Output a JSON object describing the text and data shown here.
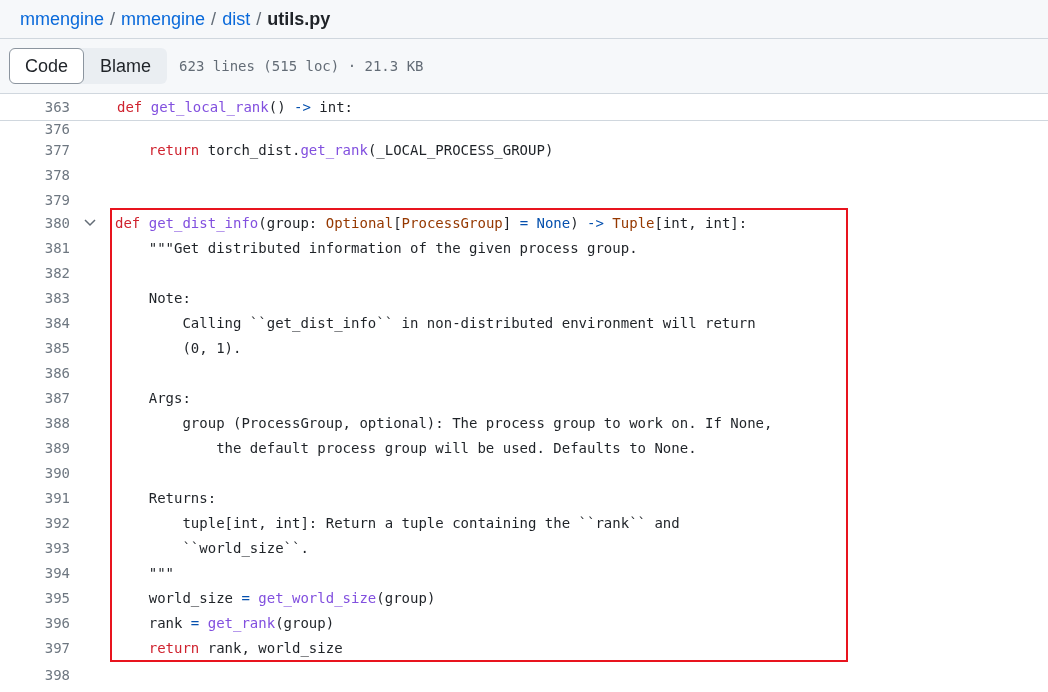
{
  "breadcrumb": [
    {
      "label": "mmengine",
      "kind": "link"
    },
    {
      "label": "/",
      "kind": "sep"
    },
    {
      "label": "mmengine",
      "kind": "link"
    },
    {
      "label": "/",
      "kind": "sep"
    },
    {
      "label": "dist",
      "kind": "link"
    },
    {
      "label": "/",
      "kind": "sep"
    },
    {
      "label": "utils.py",
      "kind": "current"
    }
  ],
  "tabs": [
    {
      "label": "Code",
      "selected": true
    },
    {
      "label": "Blame",
      "selected": false
    }
  ],
  "file_info": "623 lines (515 loc) · 21.3 KB",
  "sticky_line": {
    "number": "363",
    "tokens": [
      {
        "t": "def ",
        "color": "#cf222e"
      },
      {
        "t": "get_local_rank",
        "color": "#8250df"
      },
      {
        "t": "() ",
        "color": "#1f2328"
      },
      {
        "t": "->",
        "color": "#0550ae"
      },
      {
        "t": " int:",
        "color": "#1f2328"
      }
    ]
  },
  "lines_before": [
    {
      "number": "376",
      "kind": "partial"
    },
    {
      "number": "377",
      "kind": "plain",
      "tokens": [
        {
          "t": "    return ",
          "color": "#cf222e"
        },
        {
          "t": "torch_dist.",
          "color": "#1f2328"
        },
        {
          "t": "get_rank",
          "color": "#8250df"
        },
        {
          "t": "(_LOCAL_PROCESS_GROUP)",
          "color": "#1f2328"
        }
      ]
    },
    {
      "number": "378",
      "kind": "plain"
    },
    {
      "number": "379",
      "kind": "plain"
    }
  ],
  "highlighted_lines": [
    {
      "number": "380",
      "kind": "foldable",
      "tokens": [
        {
          "t": "def ",
          "color": "#cf222e"
        },
        {
          "t": "get_dist_info",
          "color": "#8250df"
        },
        {
          "t": "(group: ",
          "color": "#1f2328"
        },
        {
          "t": "Optional",
          "color": "#953800"
        },
        {
          "t": "[",
          "color": "#1f2328"
        },
        {
          "t": "ProcessGroup",
          "color": "#953800"
        },
        {
          "t": "] ",
          "color": "#1f2328"
        },
        {
          "t": "= None",
          "color": "#0550ae"
        },
        {
          "t": ") ",
          "color": "#1f2328"
        },
        {
          "t": "-> ",
          "color": "#0550ae"
        },
        {
          "t": "Tuple",
          "color": "#953800"
        },
        {
          "t": "[int, int]:",
          "color": "#1f2328"
        }
      ]
    },
    {
      "number": "381",
      "kind": "plain",
      "tokens": [
        {
          "t": "    \"\"\"Get distributed information of the given process group.",
          "color": "#1f2328"
        }
      ]
    },
    {
      "number": "382",
      "kind": "plain"
    },
    {
      "number": "383",
      "kind": "plain",
      "tokens": [
        {
          "t": "    Note:",
          "color": "#1f2328"
        }
      ]
    },
    {
      "number": "384",
      "kind": "plain",
      "tokens": [
        {
          "t": "        Calling ``get_dist_info`` in non-distributed environment will return",
          "color": "#1f2328"
        }
      ]
    },
    {
      "number": "385",
      "kind": "plain",
      "tokens": [
        {
          "t": "        (0, 1).",
          "color": "#1f2328"
        }
      ]
    },
    {
      "number": "386",
      "kind": "plain"
    },
    {
      "number": "387",
      "kind": "plain",
      "tokens": [
        {
          "t": "    Args:",
          "color": "#1f2328"
        }
      ]
    },
    {
      "number": "388",
      "kind": "plain",
      "tokens": [
        {
          "t": "        group (ProcessGroup, optional): The process group to work on. If None,",
          "color": "#1f2328"
        }
      ]
    },
    {
      "number": "389",
      "kind": "plain",
      "tokens": [
        {
          "t": "            the default process group will be used. Defaults to None.",
          "color": "#1f2328"
        }
      ]
    },
    {
      "number": "390",
      "kind": "plain"
    },
    {
      "number": "391",
      "kind": "plain",
      "tokens": [
        {
          "t": "    Returns:",
          "color": "#1f2328"
        }
      ]
    },
    {
      "number": "392",
      "kind": "plain",
      "tokens": [
        {
          "t": "        tuple[int, int]: Return a tuple containing the ``rank`` and",
          "color": "#1f2328"
        }
      ]
    },
    {
      "number": "393",
      "kind": "plain",
      "tokens": [
        {
          "t": "        ``world_size``.",
          "color": "#1f2328"
        }
      ]
    },
    {
      "number": "394",
      "kind": "plain",
      "tokens": [
        {
          "t": "    \"\"\"",
          "color": "#1f2328"
        }
      ]
    },
    {
      "number": "395",
      "kind": "plain",
      "tokens": [
        {
          "t": "    world_size ",
          "color": "#1f2328"
        },
        {
          "t": "= ",
          "color": "#0550ae"
        },
        {
          "t": "get_world_size",
          "color": "#8250df"
        },
        {
          "t": "(group)",
          "color": "#1f2328"
        }
      ]
    },
    {
      "number": "396",
      "kind": "plain",
      "tokens": [
        {
          "t": "    rank ",
          "color": "#1f2328"
        },
        {
          "t": "= ",
          "color": "#0550ae"
        },
        {
          "t": "get_rank",
          "color": "#8250df"
        },
        {
          "t": "(group)",
          "color": "#1f2328"
        }
      ]
    },
    {
      "number": "397",
      "kind": "plain",
      "tokens": [
        {
          "t": "    return ",
          "color": "#cf222e"
        },
        {
          "t": "rank, world_size",
          "color": "#1f2328"
        }
      ]
    }
  ],
  "lines_after": [
    {
      "number": "398"
    }
  ]
}
